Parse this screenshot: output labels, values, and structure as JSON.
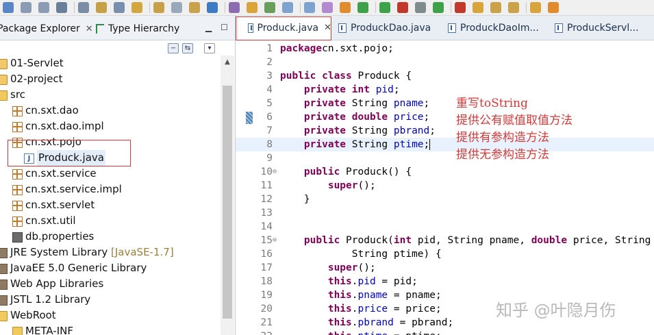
{
  "left_panel": {
    "tabs": [
      {
        "label": "Package Explorer",
        "close": "✕"
      },
      {
        "label": "Type Hierarchy"
      }
    ],
    "tree": [
      {
        "label": "01-Servlet",
        "type": "project",
        "arrow": "›",
        "depth": 0
      },
      {
        "label": "02-project",
        "type": "project",
        "arrow": "⌄",
        "depth": 0
      },
      {
        "label": "src",
        "type": "folder",
        "arrow": "⌄",
        "depth": 1
      },
      {
        "label": "cn.sxt.dao",
        "type": "package",
        "arrow": "›",
        "depth": 2
      },
      {
        "label": "cn.sxt.dao.impl",
        "type": "package",
        "arrow": "›",
        "depth": 2
      },
      {
        "label": "cn.sxt.pojo",
        "type": "package",
        "arrow": "⌄",
        "depth": 2
      },
      {
        "label": "Produck.java",
        "type": "java",
        "arrow": "›",
        "depth": 3
      },
      {
        "label": "cn.sxt.service",
        "type": "package",
        "arrow": "›",
        "depth": 2
      },
      {
        "label": "cn.sxt.service.impl",
        "type": "package",
        "arrow": "›",
        "depth": 2
      },
      {
        "label": "cn.sxt.servlet",
        "type": "package",
        "arrow": "›",
        "depth": 2
      },
      {
        "label": "cn.sxt.util",
        "type": "package",
        "arrow": "›",
        "depth": 2
      },
      {
        "label": "db.properties",
        "type": "properties",
        "arrow": "",
        "depth": 2
      },
      {
        "label": "JRE System Library",
        "decor": "[JavaSE-1.7]",
        "type": "library",
        "arrow": "›",
        "depth": 1
      },
      {
        "label": "JavaEE 5.0 Generic Library",
        "type": "library",
        "arrow": "›",
        "depth": 1
      },
      {
        "label": "Web App Libraries",
        "type": "library",
        "arrow": "›",
        "depth": 1
      },
      {
        "label": "JSTL 1.2 Library",
        "type": "library",
        "arrow": "›",
        "depth": 1
      },
      {
        "label": "WebRoot",
        "type": "folder",
        "arrow": "⌄",
        "depth": 1
      },
      {
        "label": "META-INF",
        "type": "folder",
        "arrow": "›",
        "depth": 2
      }
    ]
  },
  "editor": {
    "tabs": [
      {
        "label": "Produck.java",
        "close": "✕"
      },
      {
        "label": "ProduckDao.java"
      },
      {
        "label": "ProduckDaoIm..."
      },
      {
        "label": "ProduckServl..."
      }
    ],
    "current_line": 8,
    "lines": [
      {
        "n": "1",
        "fold": "",
        "tokens": [
          [
            "kw",
            "package"
          ],
          [
            "",
            "cn.sxt.pojo;"
          ]
        ]
      },
      {
        "n": "2",
        "fold": "",
        "tokens": []
      },
      {
        "n": "3",
        "fold": "",
        "tokens": [
          [
            "kw",
            "public class"
          ],
          [
            "",
            " Produck {"
          ]
        ]
      },
      {
        "n": "4",
        "fold": "",
        "tokens": [
          [
            "",
            "    "
          ],
          [
            "kw",
            "private int"
          ],
          [
            "",
            " "
          ],
          [
            "fld",
            "pid"
          ],
          [
            "",
            ";"
          ]
        ]
      },
      {
        "n": "5",
        "fold": "",
        "tokens": [
          [
            "",
            "    "
          ],
          [
            "kw",
            "private"
          ],
          [
            "",
            " String "
          ],
          [
            "fld",
            "pname"
          ],
          [
            "",
            ";"
          ]
        ]
      },
      {
        "n": "6",
        "fold": "",
        "tokens": [
          [
            "",
            "    "
          ],
          [
            "kw",
            "private double"
          ],
          [
            "",
            " "
          ],
          [
            "fld",
            "price"
          ],
          [
            "",
            ";"
          ]
        ]
      },
      {
        "n": "7",
        "fold": "",
        "tokens": [
          [
            "",
            "    "
          ],
          [
            "kw",
            "private"
          ],
          [
            "",
            " String "
          ],
          [
            "fld",
            "pbrand"
          ],
          [
            "",
            ";"
          ]
        ]
      },
      {
        "n": "8",
        "fold": "",
        "tokens": [
          [
            "",
            "    "
          ],
          [
            "kw",
            "private"
          ],
          [
            "",
            " String "
          ],
          [
            "fld",
            "ptime"
          ],
          [
            "",
            ";"
          ]
        ]
      },
      {
        "n": "9",
        "fold": "",
        "tokens": []
      },
      {
        "n": "10",
        "fold": "⊖",
        "tokens": [
          [
            "",
            "    "
          ],
          [
            "kw",
            "public"
          ],
          [
            "",
            " Produck() {"
          ]
        ]
      },
      {
        "n": "11",
        "fold": "",
        "tokens": [
          [
            "",
            "        "
          ],
          [
            "kw",
            "super"
          ],
          [
            "",
            "();"
          ]
        ]
      },
      {
        "n": "12",
        "fold": "",
        "tokens": [
          [
            "",
            "    }"
          ]
        ]
      },
      {
        "n": "13",
        "fold": "",
        "tokens": []
      },
      {
        "n": "14",
        "fold": "",
        "tokens": []
      },
      {
        "n": "15",
        "fold": "⊖",
        "tokens": [
          [
            "",
            "    "
          ],
          [
            "kw",
            "public"
          ],
          [
            "",
            " Produck("
          ],
          [
            "kw",
            "int"
          ],
          [
            "",
            " pid, String pname, "
          ],
          [
            "kw",
            "double"
          ],
          [
            "",
            " price, String pbrand,"
          ]
        ]
      },
      {
        "n": "16",
        "fold": "",
        "tokens": [
          [
            "",
            "            String ptime) {"
          ]
        ]
      },
      {
        "n": "17",
        "fold": "",
        "tokens": [
          [
            "",
            "        "
          ],
          [
            "kw",
            "super"
          ],
          [
            "",
            "();"
          ]
        ]
      },
      {
        "n": "18",
        "fold": "",
        "tokens": [
          [
            "",
            "        "
          ],
          [
            "kw",
            "this"
          ],
          [
            "",
            "."
          ],
          [
            "fld",
            "pid"
          ],
          [
            "",
            " = pid;"
          ]
        ]
      },
      {
        "n": "19",
        "fold": "",
        "tokens": [
          [
            "",
            "        "
          ],
          [
            "kw",
            "this"
          ],
          [
            "",
            "."
          ],
          [
            "fld",
            "pname"
          ],
          [
            "",
            " = pname;"
          ]
        ]
      },
      {
        "n": "20",
        "fold": "",
        "tokens": [
          [
            "",
            "        "
          ],
          [
            "kw",
            "this"
          ],
          [
            "",
            "."
          ],
          [
            "fld",
            "price"
          ],
          [
            "",
            " = price;"
          ]
        ]
      },
      {
        "n": "21",
        "fold": "",
        "tokens": [
          [
            "",
            "        "
          ],
          [
            "kw",
            "this"
          ],
          [
            "",
            "."
          ],
          [
            "fld",
            "pbrand"
          ],
          [
            "",
            " = pbrand;"
          ]
        ]
      },
      {
        "n": "22",
        "fold": "",
        "tokens": [
          [
            "",
            "        "
          ],
          [
            "kw",
            "this"
          ],
          [
            "",
            "."
          ],
          [
            "fld",
            "ptime"
          ],
          [
            "",
            " = ptime;"
          ]
        ]
      }
    ]
  },
  "annotations": [
    "重写toString",
    "提供公有赋值取值方法",
    "提供有参构造方法",
    "提供无参构造方法"
  ],
  "watermark": "知乎 @叶隐月伤",
  "colors": {
    "keyword": "#7f0055",
    "field": "#0000c0",
    "annotation": "#d23a3a",
    "current_line": "#e8f2fe"
  }
}
